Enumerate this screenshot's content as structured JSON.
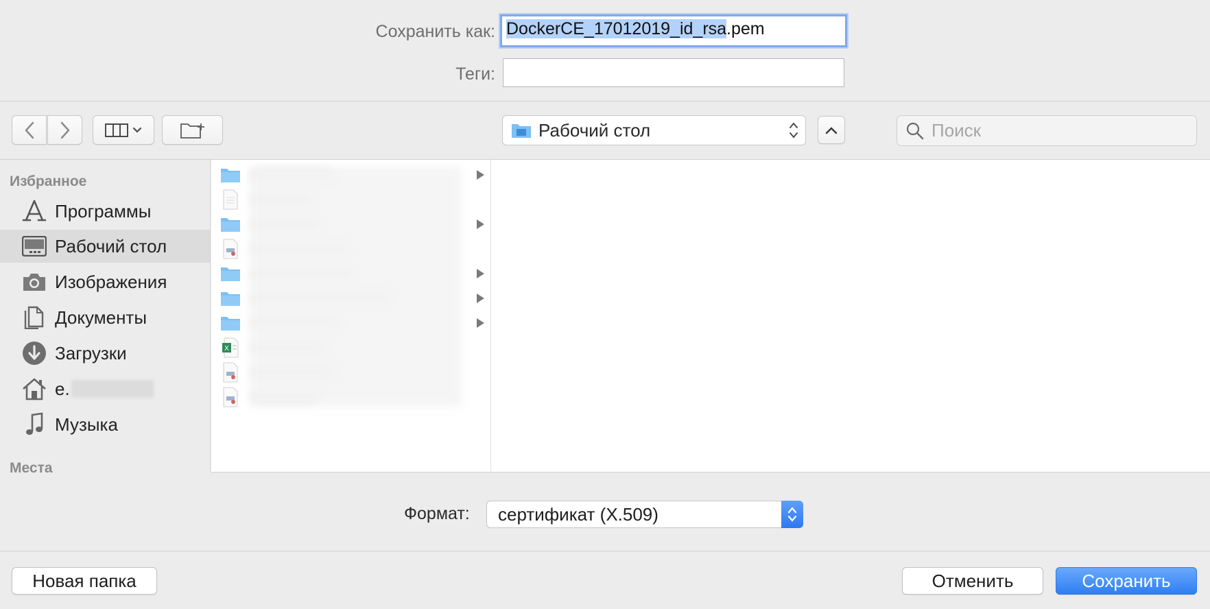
{
  "save_as": {
    "label": "Сохранить как:",
    "filename_selected": "DockerCE_17012019_id_rsa",
    "filename_ext": ".pem"
  },
  "tags": {
    "label": "Теги:",
    "value": ""
  },
  "toolbar": {
    "location": "Рабочий стол",
    "search_placeholder": "Поиск"
  },
  "sidebar": {
    "favorites_header": "Избранное",
    "items": [
      {
        "label": "Программы",
        "icon": "applications-icon"
      },
      {
        "label": "Рабочий стол",
        "icon": "desktop-icon",
        "selected": true
      },
      {
        "label": "Изображения",
        "icon": "camera-icon"
      },
      {
        "label": "Документы",
        "icon": "documents-icon"
      },
      {
        "label": "Загрузки",
        "icon": "downloads-icon"
      },
      {
        "label": "e.",
        "icon": "home-icon"
      },
      {
        "label": "Музыка",
        "icon": "music-icon"
      }
    ],
    "places_header": "Места"
  },
  "format": {
    "label": "Формат:",
    "value": "сертификат (X.509)"
  },
  "buttons": {
    "new_folder": "Новая папка",
    "cancel": "Отменить",
    "save": "Сохранить"
  },
  "colors": {
    "accent": "#2f7ef3",
    "selection": "#b3d2f9",
    "folder": "#7cc0f4"
  }
}
